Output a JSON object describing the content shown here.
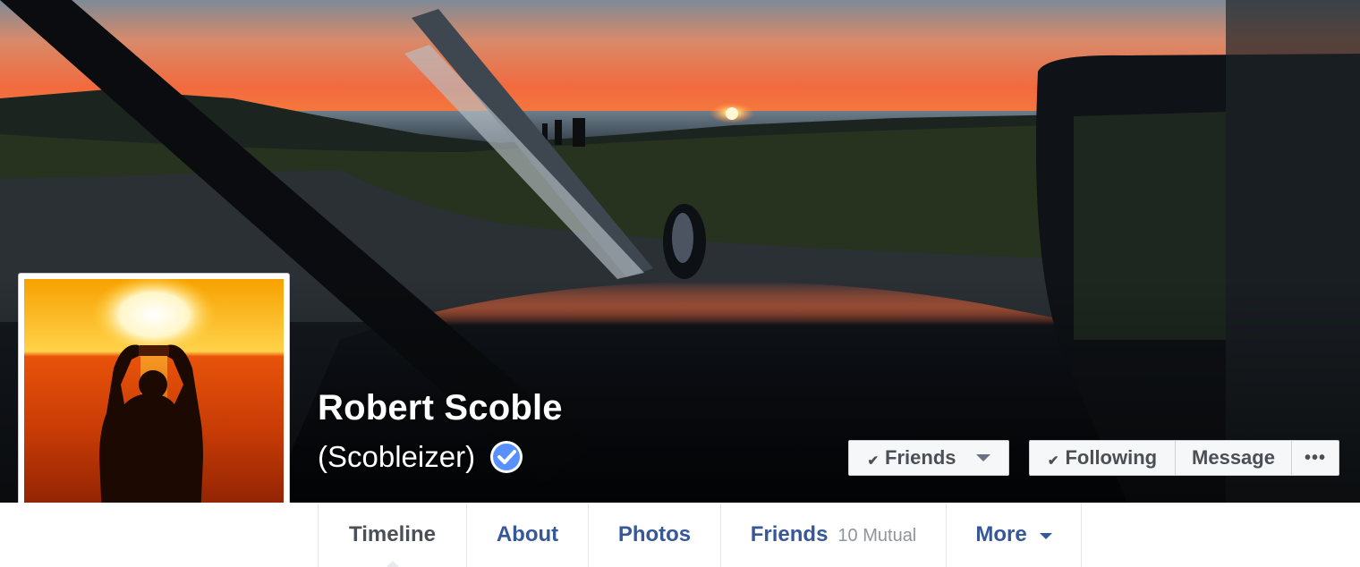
{
  "profile": {
    "name": "Robert Scoble",
    "alternate_name": "(Scobleizer)",
    "verified_badge_icon": "verified-check-icon"
  },
  "actions": {
    "friends_label": "Friends",
    "following_label": "Following",
    "message_label": "Message",
    "more_label": "•••"
  },
  "tabs": [
    {
      "label": "Timeline",
      "active": true
    },
    {
      "label": "About"
    },
    {
      "label": "Photos"
    },
    {
      "label": "Friends",
      "sub": "10 Mutual"
    },
    {
      "label": "More"
    }
  ],
  "colors": {
    "link_blue": "#365899",
    "verified_blue": "#5890ff",
    "button_bg": "#f6f7f9",
    "page_bg": "#e9eaed"
  }
}
